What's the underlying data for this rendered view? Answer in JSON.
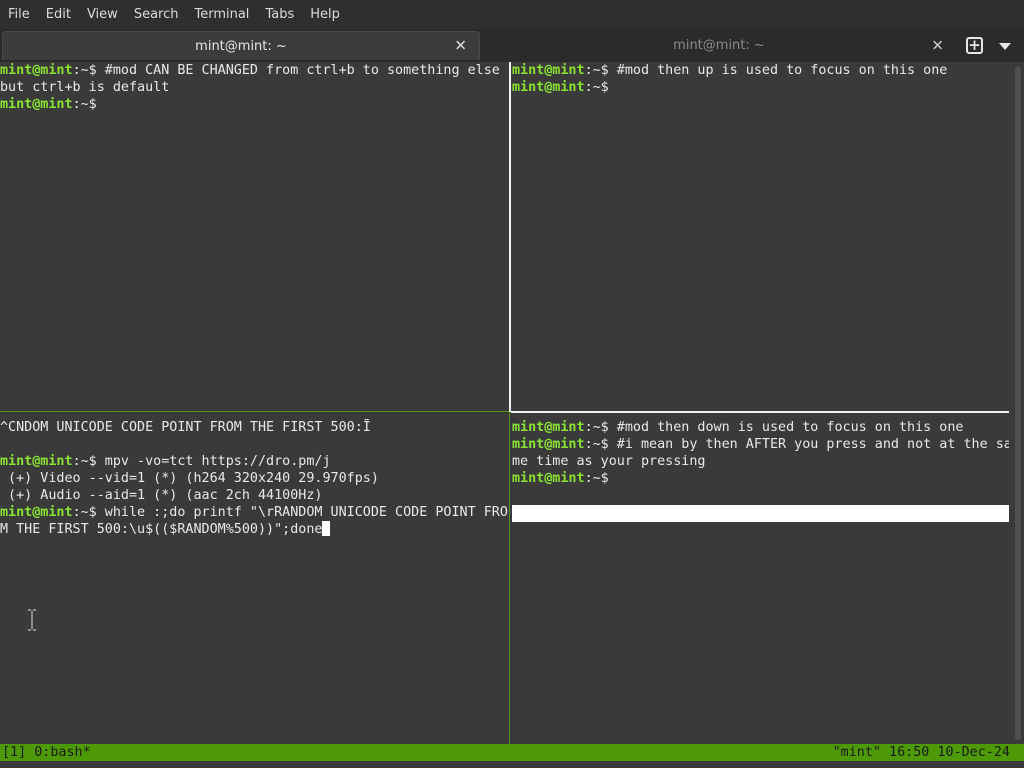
{
  "menubar": {
    "items": [
      "File",
      "Edit",
      "View",
      "Search",
      "Terminal",
      "Tabs",
      "Help"
    ]
  },
  "tabs": [
    {
      "title": "mint@mint: ~",
      "active": true,
      "close_glyph": "✕"
    },
    {
      "title": "mint@mint: ~",
      "active": false,
      "close_glyph": "✕"
    }
  ],
  "tab_actions": {
    "new_tab_glyph": "+",
    "new_tab_icon": "new-tab-icon",
    "menu_icon": "dropdown-arrow-icon"
  },
  "prompt": {
    "user_host": "mint@mint",
    "suffix": ":~$"
  },
  "panes": {
    "top_left": {
      "lines": [
        {
          "prompt": true,
          "text": " #mod CAN BE CHANGED from ctrl+b to something else"
        },
        {
          "prompt": false,
          "text": "but ctrl+b is default"
        },
        {
          "prompt": true,
          "text": ""
        }
      ]
    },
    "top_right": {
      "lines": [
        {
          "prompt": true,
          "text": " #mod then up is used to focus on this one"
        },
        {
          "prompt": true,
          "text": ""
        }
      ]
    },
    "bottom_left": {
      "lines": [
        {
          "prompt": false,
          "text": "^CNDOM UNICODE CODE POINT FROM THE FIRST 500:Ī"
        },
        {
          "prompt": false,
          "text": ""
        },
        {
          "prompt": true,
          "text": " mpv -vo=tct https://dro.pm/j"
        },
        {
          "prompt": false,
          "text": " (+) Video --vid=1 (*) (h264 320x240 29.970fps)"
        },
        {
          "prompt": false,
          "text": " (+) Audio --aid=1 (*) (aac 2ch 44100Hz)"
        },
        {
          "prompt": true,
          "text": " while :;do printf \"\\rRANDOM UNICODE CODE POINT FRO"
        },
        {
          "prompt": false,
          "text": "M THE FIRST 500:\\u$(($RANDOM%500))\";done",
          "cursor": true
        }
      ]
    },
    "bottom_right": {
      "lines": [
        {
          "prompt": true,
          "text": " #mod then down is used to focus on this one"
        },
        {
          "prompt": true,
          "text": " #i mean by then AFTER you press and not at the sa"
        },
        {
          "prompt": false,
          "text": "me time as your pressing"
        },
        {
          "prompt": true,
          "text": ""
        }
      ]
    }
  },
  "statusbar": {
    "left": "[1] 0:bash*",
    "right": "\"mint\" 16:50 10-Dec-24"
  },
  "colors": {
    "prompt": "#8ae234",
    "status_bg": "#4e9a06",
    "active_border": "#f2f2f2",
    "inactive_border": "#4e9a06",
    "terminal_bg": "#3a3a3a"
  }
}
